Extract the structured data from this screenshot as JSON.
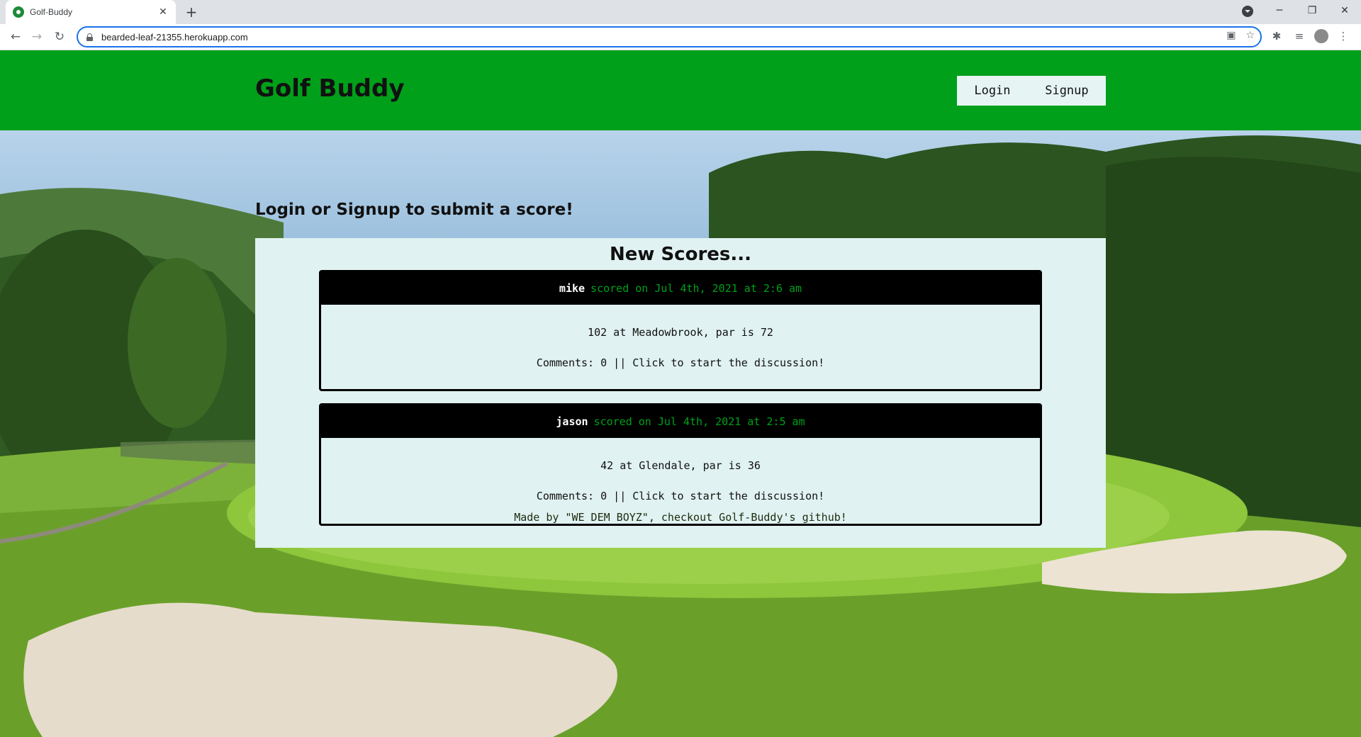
{
  "browser": {
    "tab_title": "Golf-Buddy",
    "url": "bearded-leaf-21355.herokuapp.com"
  },
  "navbar": {
    "brand": "Golf Buddy",
    "login_label": "Login",
    "signup_label": "Signup"
  },
  "main": {
    "prompt": "Login or Signup to submit a score!",
    "scores_heading": "New Scores...",
    "scores": [
      {
        "user": "mike",
        "date_text": "scored on Jul 4th, 2021 at 2:6 am",
        "result": "102 at Meadowbrook, par is 72",
        "comments": "Comments: 0 || Click to start the discussion!"
      },
      {
        "user": "jason",
        "date_text": "scored on Jul 4th, 2021 at 2:5 am",
        "result": "42 at Glendale, par is 36",
        "comments": "Comments: 0 || Click to start the discussion!"
      }
    ]
  },
  "footer": {
    "text": "Made by \"WE DEM BOYZ\", checkout Golf-Buddy's github!"
  },
  "colors": {
    "navbar_green": "#00a01a",
    "panel_bg": "#e0f2f1",
    "card_header_bg": "#000000",
    "date_text_green": "#00a01a"
  }
}
